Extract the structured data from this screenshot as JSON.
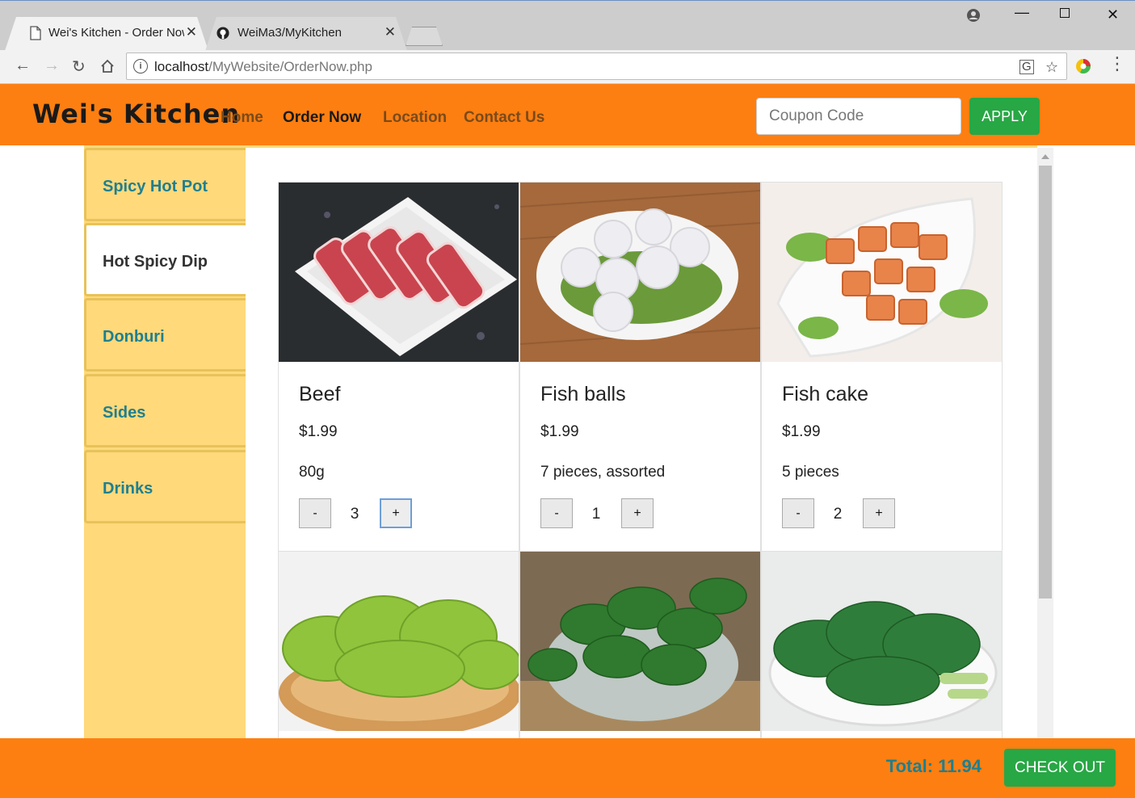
{
  "browser": {
    "tabs": [
      {
        "title": "Wei's Kitchen - Order Now",
        "icon": "page-icon",
        "active": true
      },
      {
        "title": "WeiMa3/MyKitchen",
        "icon": "github-icon",
        "active": false
      }
    ],
    "url_host": "localhost",
    "url_path": "/MyWebsite/OrderNow.php"
  },
  "header": {
    "brand": "Wei's Kitchen",
    "nav": [
      {
        "label": "Home",
        "active": false
      },
      {
        "label": "Order Now",
        "active": true
      },
      {
        "label": "Location",
        "active": false
      },
      {
        "label": "Contact Us",
        "active": false
      }
    ],
    "coupon_placeholder": "Coupon Code",
    "apply_label": "APPLY"
  },
  "sidebar": {
    "items": [
      {
        "label": "Spicy Hot Pot",
        "active": false
      },
      {
        "label": "Hot Spicy Dip",
        "active": true
      },
      {
        "label": "Donburi",
        "active": false
      },
      {
        "label": "Sides",
        "active": false
      },
      {
        "label": "Drinks",
        "active": false
      }
    ]
  },
  "products": [
    {
      "name": "Beef",
      "price": "$1.99",
      "desc": "80g",
      "qty": "3",
      "image": "beef-slices"
    },
    {
      "name": "Fish balls",
      "price": "$1.99",
      "desc": "7 pieces, assorted",
      "qty": "1",
      "image": "fish-balls"
    },
    {
      "name": "Fish cake",
      "price": "$1.99",
      "desc": "5 pieces",
      "qty": "2",
      "image": "fish-cake"
    },
    {
      "image": "lettuce"
    },
    {
      "image": "spinach"
    },
    {
      "image": "bok-choy"
    }
  ],
  "qty_controls": {
    "minus": "-",
    "plus": "+"
  },
  "footer": {
    "total": "Total: 11.94",
    "checkout_label": "CHECK OUT"
  },
  "colors": {
    "header_orange": "#fd7f11",
    "sidebar_yellow": "#ffd97a",
    "accent_teal": "#1f7f8f",
    "button_green": "#28a745"
  }
}
